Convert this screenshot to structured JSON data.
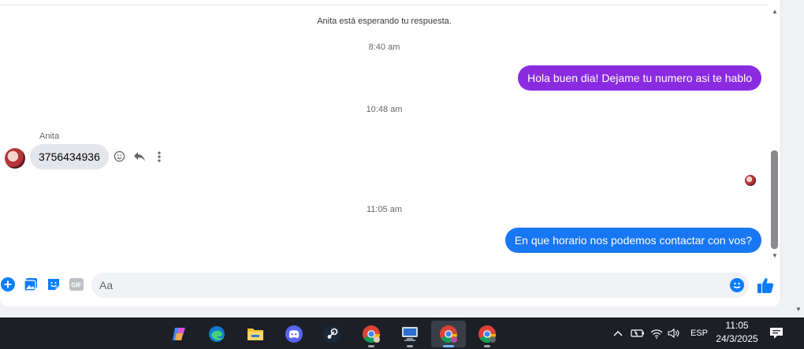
{
  "chat": {
    "typing_notice": "Anita está esperando tu respuesta.",
    "timestamps": [
      "8:40 am",
      "10:48 am",
      "11:05 am"
    ],
    "outgoing": [
      "Hola buen dia! Dejame tu numero asi te hablo",
      "En que horario nos podemos contactar con vos?"
    ],
    "incoming": {
      "sender": "Anita",
      "text": "3756434936"
    }
  },
  "composer": {
    "placeholder": "Aa"
  },
  "taskbar": {
    "apps": [
      "copilot-icon",
      "edge-icon",
      "file-explorer-icon",
      "discord-icon",
      "steam-icon",
      "chrome-icon",
      "network-app-icon",
      "chrome-profile-icon",
      "chrome-profile-c-icon"
    ],
    "language": "ESP",
    "time": "11:05",
    "date": "24/3/2025"
  },
  "colors": {
    "outgoing_purple": "#8a2be2",
    "outgoing_blue": "#1877f2",
    "incoming_gray": "#e4e6eb",
    "accent": "#0a7cff"
  }
}
